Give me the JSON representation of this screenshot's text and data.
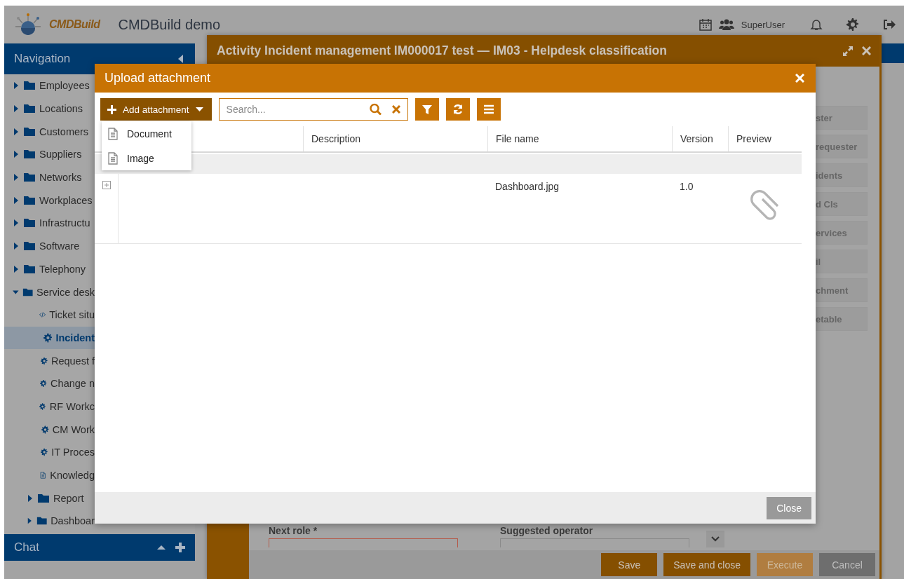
{
  "header": {
    "logo": "CMDBuild",
    "title": "CMDBuild demo",
    "user": "SuperUser"
  },
  "navigation": {
    "title": "Navigation",
    "items": [
      {
        "label": "Employees",
        "kind": "folder",
        "expanded": false,
        "selected": false
      },
      {
        "label": "Locations",
        "kind": "folder",
        "expanded": false,
        "selected": false
      },
      {
        "label": "Customers",
        "kind": "folder",
        "expanded": false,
        "selected": false
      },
      {
        "label": "Suppliers",
        "kind": "folder",
        "expanded": false,
        "selected": false
      },
      {
        "label": "Networks",
        "kind": "folder",
        "expanded": false,
        "selected": false
      },
      {
        "label": "Workplaces",
        "kind": "folder",
        "expanded": false,
        "selected": false
      },
      {
        "label": "Infrastructu",
        "kind": "folder",
        "expanded": false,
        "selected": false
      },
      {
        "label": "Software",
        "kind": "folder",
        "expanded": false,
        "selected": false
      },
      {
        "label": "Telephony",
        "kind": "folder",
        "expanded": false,
        "selected": false
      },
      {
        "label": "Service desk",
        "kind": "folder",
        "expanded": true,
        "selected": false,
        "children": [
          {
            "label": "Ticket situ",
            "kind": "script",
            "selected": false
          },
          {
            "label": "Incident",
            "kind": "process",
            "selected": true
          },
          {
            "label": "Request f",
            "kind": "process",
            "selected": false
          },
          {
            "label": "Change n",
            "kind": "process",
            "selected": false
          },
          {
            "label": "RF Workc",
            "kind": "process",
            "selected": false
          },
          {
            "label": "CM Work",
            "kind": "process",
            "selected": false
          },
          {
            "label": "IT Proces",
            "kind": "process",
            "selected": false
          },
          {
            "label": "Knowledg",
            "kind": "document",
            "selected": false
          },
          {
            "label": "Report",
            "kind": "folder",
            "expanded": false,
            "selected": false
          },
          {
            "label": "Dashboar",
            "kind": "folder",
            "expanded": false,
            "selected": false
          }
        ]
      }
    ]
  },
  "chat": {
    "title": "Chat"
  },
  "activity_window": {
    "title": "Activity Incident management IM000017 test — IM03 - Helpdesk classification",
    "side_tabs": [
      "ster",
      "requester",
      "idents",
      "d CIs",
      "ervices",
      "il",
      "chment",
      "etable"
    ],
    "fields": [
      {
        "label": "Next role *",
        "invalid": true
      },
      {
        "label": "Suggested operator",
        "invalid": false
      }
    ],
    "buttons": [
      {
        "label": "Save",
        "disabled": false,
        "kind": "primary"
      },
      {
        "label": "Save and close",
        "disabled": false,
        "kind": "primary"
      },
      {
        "label": "Execute",
        "disabled": true,
        "kind": "primary"
      },
      {
        "label": "Cancel",
        "disabled": false,
        "kind": "secondary"
      }
    ]
  },
  "upload_dialog": {
    "title": "Upload attachment",
    "add_button": "Add attachment",
    "search": {
      "placeholder": "Search..."
    },
    "menu": [
      {
        "label": "Document"
      },
      {
        "label": "Image"
      }
    ],
    "columns": [
      "Description",
      "File name",
      "Version",
      "Preview"
    ],
    "rows": [
      {
        "file_name": "Dashboard.jpg",
        "version": "1.0",
        "expanded": false
      }
    ],
    "close_button": "Close"
  }
}
